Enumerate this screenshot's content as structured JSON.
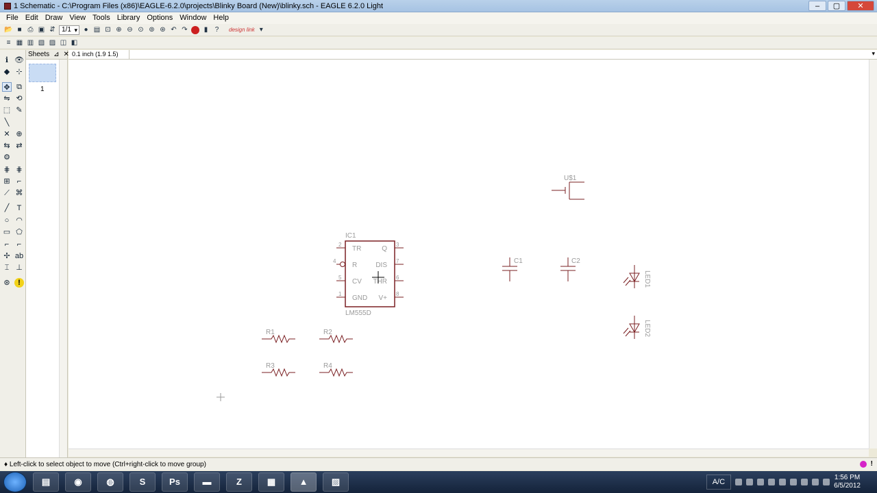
{
  "window": {
    "title": "1 Schematic - C:\\Program Files (x86)\\EAGLE-6.2.0\\projects\\Blinky Board (New)\\blinky.sch - EAGLE 6.2.0 Light",
    "minimize": "–",
    "maximize": "▢",
    "close": "✕"
  },
  "menu": [
    "File",
    "Edit",
    "Draw",
    "View",
    "Tools",
    "Library",
    "Options",
    "Window",
    "Help"
  ],
  "toolbar": {
    "sheet_select": "1/1",
    "brand": "design link"
  },
  "sheets_panel": {
    "title": "Sheets",
    "sheet_number": "1"
  },
  "coord": {
    "readout": "0.1 inch (1.9 1.5)"
  },
  "schematic": {
    "ic": {
      "name": "IC1",
      "value": "LM555D",
      "pins_left": [
        {
          "num": "2",
          "label": "TR"
        },
        {
          "num": "4",
          "label": "R"
        },
        {
          "num": "5",
          "label": "CV"
        },
        {
          "num": "1",
          "label": "GND"
        }
      ],
      "pins_right": [
        {
          "num": "3",
          "label": "Q"
        },
        {
          "num": "7",
          "label": "DIS"
        },
        {
          "num": "6",
          "label": "THR"
        },
        {
          "num": "8",
          "label": "V+"
        }
      ]
    },
    "battery": {
      "name": "U$1"
    },
    "capacitors": [
      "C1",
      "C2"
    ],
    "leds": [
      "LED1",
      "LED2"
    ],
    "resistors": [
      "R1",
      "R2",
      "R3",
      "R4"
    ]
  },
  "status": {
    "message": "♦ Left-click to select object to move (Ctrl+right-click to move group)"
  },
  "taskbar": {
    "filezilla_label": "Z",
    "photoshop_label": "Ps",
    "lang": "A/C",
    "time": "1:56 PM",
    "date": "6/5/2012"
  },
  "colors": {
    "schematic_red": "#7a1f22",
    "label_gray": "#9a9a9a"
  }
}
